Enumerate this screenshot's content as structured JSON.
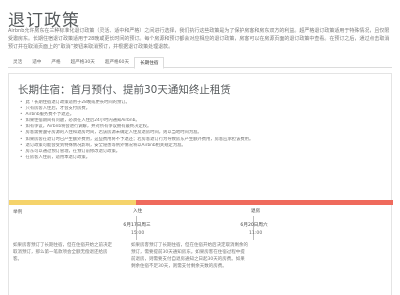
{
  "page": {
    "title": "退订政策",
    "intro": "Airbnb允许房东在三种标准化退订政策（灵活、适中和严格）之间进行选择，我们执行这些政策是为了保护房客和房东双方的利益。超严格退订政策适用于特殊情况，且仅限受邀房东。长期住宿退订政策适用于28晚或更长时间的预订。每个房源和预订都会对应相应的退订政策，房客可以在房源页面的退订政策中查看。在预订之后，通过点击取消预订并在取消页面上的“取消”按钮来取消预订，并根据退订政策处理退款。"
  },
  "tabs": [
    {
      "label": "灵活",
      "active": false
    },
    {
      "label": "适中",
      "active": false
    },
    {
      "label": "严格",
      "active": false
    },
    {
      "label": "超严格30天",
      "active": false
    },
    {
      "label": "超严格60天",
      "active": false
    },
    {
      "label": "长期住宿",
      "active": true
    }
  ],
  "policy": {
    "title": "长期住宿：首月预付、提前30天通知终止租赁",
    "rules": [
      "此「长期住宿退订政策适用于28晚或更长时间的预订。",
      "只有房客入住后，才会支付房费。",
      "Airbnb服务费不予退还。",
      "如果住宿期间有问题，必须在入住后24小时内通知Airbnb。",
      "如有争议，Airbnb将会进行调解，并对所有争议拥有最终决定权。",
      "房客需要遵守房源的入住和退房时间，若该房源未确定入住及退房时间，则以当地时间为准。",
      "如果房客在退订时已产生额外费用，这些费用将不予退还；若房客退订行为导致房东产生额外费用，房客应承担该费用。",
      "退订政策可能会受到特殊情况影响，安全隐患等例外情况将以Airbnb相关规定为准。",
      "房东可以通过预订管理，在预订前修改退订政策。",
      "在房客入住前，适用本退订政策。"
    ]
  },
  "timeline": {
    "checkin_label": "入住",
    "checkout_label": "退房",
    "left_label": "举例",
    "checkin_date": "6月17日周三",
    "checkin_time": "15:00",
    "checkout_date": "6月20日周六",
    "checkout_time": "11:00",
    "left_desc": "如果房客预订了长期住宿，但在住宿开始之前决定取消预订，那么第一笔款项会全额无偿退还给房客。",
    "right_desc": "如果房客预订了长期住宿，但在住宿开始后决定取消剩余的预订，需要提前30天通知房东。如果房客在住宿过程中提前退房，则需要支付自退房通知之日起30天的房费。如果剩余住宿不足30天，则需支付剩余天数的房费。",
    "colors": {
      "before": "#f5d36b",
      "after": "#ef6a5c"
    }
  }
}
